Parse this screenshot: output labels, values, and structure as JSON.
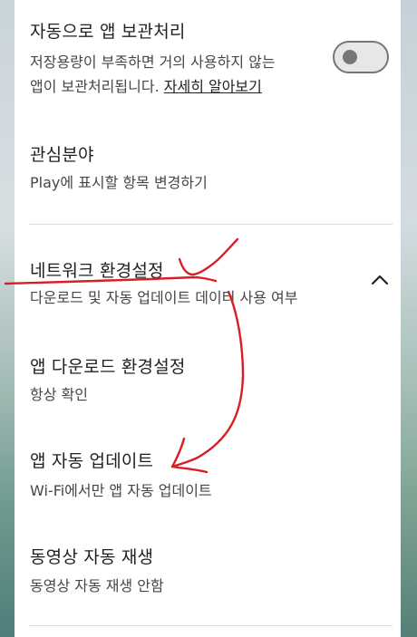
{
  "settings": {
    "auto_archive": {
      "title": "자동으로 앱 보관처리",
      "desc_line1": "저장용량이 부족하면 거의 사용하지 않는",
      "desc_line2": "앱이 보관처리됩니다.",
      "learn_more": "자세히 알아보기",
      "toggle_on": false
    },
    "interests": {
      "title": "관심분야",
      "desc": "Play에 표시할 항목 변경하기"
    },
    "network_prefs": {
      "title": "네트워크 환경설정",
      "desc": "다운로드 및 자동 업데이트 데이터 사용 여부",
      "expanded": true
    },
    "app_download_prefs": {
      "title": "앱 다운로드 환경설정",
      "desc": "항상 확인"
    },
    "auto_update": {
      "title": "앱 자동 업데이트",
      "desc": "Wi-Fi에서만 앱 자동 업데이트"
    },
    "video_autoplay": {
      "title": "동영상 자동 재생",
      "desc": "동영상 자동 재생 안함"
    }
  },
  "icons": {
    "chevron": "chevron-up-icon"
  },
  "colors": {
    "annotation": "#d81f26",
    "text_primary": "#202124",
    "text_secondary": "#444746",
    "divider": "#dadce0"
  }
}
